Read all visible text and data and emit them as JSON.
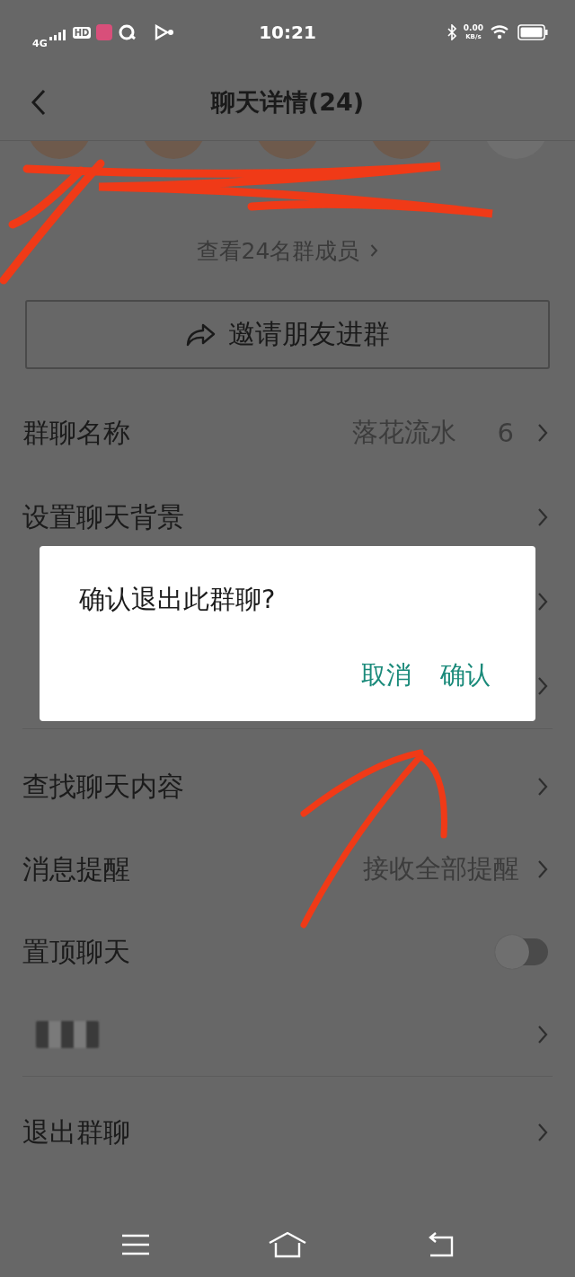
{
  "status_bar": {
    "network": "4G",
    "hd": "HD",
    "time": "10:21",
    "speed": "0.00",
    "speed_unit": "KB/s"
  },
  "header": {
    "title": "聊天详情(24)"
  },
  "members": {
    "view_all": "查看24名群成员"
  },
  "invite_button": {
    "label": "邀请朋友进群"
  },
  "groups": [
    {
      "rows": [
        {
          "kind": "link",
          "label": "群聊名称",
          "value": "落花流水",
          "suffix": "6"
        },
        {
          "kind": "link",
          "label": "设置聊天背景"
        },
        {
          "kind": "link"
        },
        {
          "kind": "link"
        }
      ]
    },
    {
      "rows": [
        {
          "kind": "link",
          "label": "查找聊天内容"
        },
        {
          "kind": "link",
          "label": "消息提醒",
          "value": "接收全部提醒"
        },
        {
          "kind": "toggle",
          "label": "置顶聊天",
          "on": false
        },
        {
          "kind": "blurred"
        }
      ]
    },
    {
      "rows": [
        {
          "kind": "link",
          "label": "退出群聊"
        }
      ]
    }
  ],
  "dialog": {
    "message": "确认退出此群聊?",
    "buttons": [
      "取消",
      "确认"
    ]
  }
}
